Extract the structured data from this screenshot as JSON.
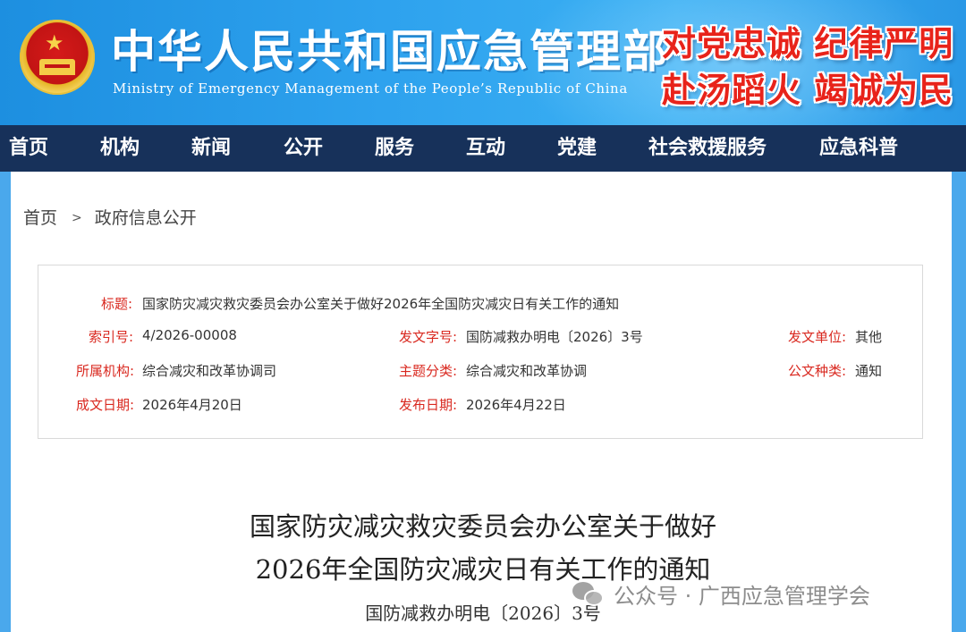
{
  "header": {
    "title": "中华人民共和国应急管理部",
    "subtitle": "Ministry of Emergency Management of the People’s Republic of China",
    "slogan_line1": "对党忠诚 纪律严明",
    "slogan_line2": "赴汤蹈火 竭诚为民",
    "emblem_icon": "national-emblem-icon",
    "colors": {
      "banner": "#2ea2ee",
      "nav": "#17315a",
      "slogan": "#e8231a",
      "label": "#d9281f"
    }
  },
  "nav": {
    "items": [
      {
        "label": "首页"
      },
      {
        "label": "机构"
      },
      {
        "label": "新闻"
      },
      {
        "label": "公开"
      },
      {
        "label": "服务"
      },
      {
        "label": "互动"
      },
      {
        "label": "党建"
      },
      {
        "label": "社会救援服务"
      },
      {
        "label": "应急科普"
      }
    ]
  },
  "breadcrumb": {
    "home": "首页",
    "separator": ">",
    "current": "政府信息公开"
  },
  "meta": {
    "title_label": "标题:",
    "title_value": "国家防灾减灾救灾委员会办公室关于做好2026年全国防灾减灾日有关工作的通知",
    "index_label": "索引号:",
    "index_value": "4/2026-00008",
    "docno_label": "发文字号:",
    "docno_value": "国防减救办明电〔2026〕3号",
    "issuer_label": "发文单位:",
    "issuer_value": "其他",
    "org_label": "所属机构:",
    "org_value": "综合减灾和改革协调司",
    "topic_label": "主题分类:",
    "topic_value": "综合减灾和改革协调",
    "type_label": "公文种类:",
    "type_value": "通知",
    "written_label": "成文日期:",
    "written_value": "2026年4月20日",
    "published_label": "发布日期:",
    "published_value": "2026年4月22日"
  },
  "document": {
    "title_line1": "国家防灾减灾救灾委员会办公室关于做好",
    "title_line2": "2026年全国防灾减灾日有关工作的通知",
    "number": "国防减救办明电〔2026〕3号"
  },
  "watermark": {
    "icon": "wechat-icon",
    "text": "公众号 · 广西应急管理学会"
  }
}
